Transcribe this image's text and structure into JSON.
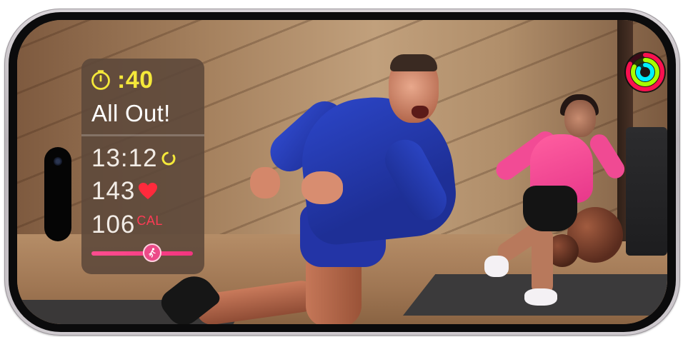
{
  "workout_metrics": {
    "interval_timer": ":40",
    "interval_status": "All Out!",
    "elapsed_time": "13:12",
    "heart_rate": "143",
    "calories": "106",
    "calories_unit": "CAL",
    "burn_bar_position": 0.6
  },
  "icons": {
    "timer": "timer-icon",
    "elapsed": "activity-ring-icon",
    "heart": "heart-icon",
    "burn_marker": "runner-icon",
    "activity": "activity-rings-icon"
  },
  "colors": {
    "timer_yellow": "#f4e83a",
    "heart_red": "#ff2a3c",
    "calories_red": "#ff3b55",
    "burn_bar_pink": "#ff4d8f",
    "ring_move": "#fa114f",
    "ring_exercise": "#a6ff00",
    "ring_stand": "#00f0ff"
  }
}
